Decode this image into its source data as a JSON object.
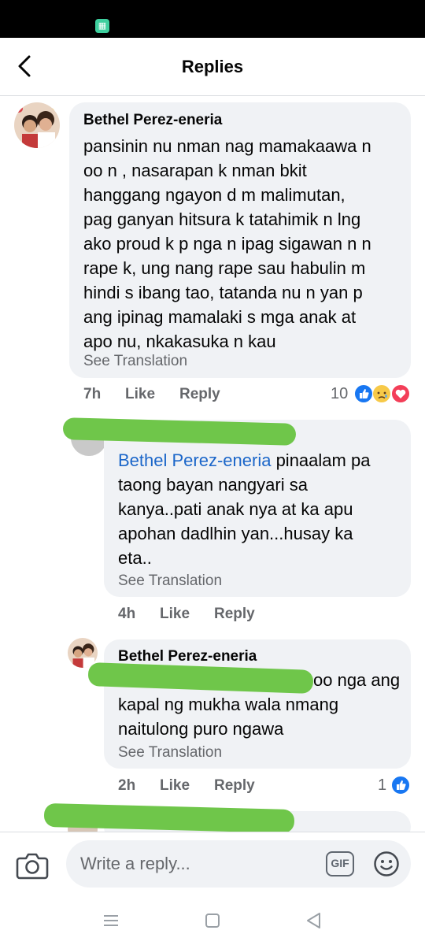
{
  "status_bar": {
    "notification_icon": "calculator-app-icon"
  },
  "header": {
    "title": "Replies",
    "back_icon": "back-arrow-icon"
  },
  "comments": [
    {
      "author": "Bethel Perez-eneria",
      "lines": [
        "pansinin nu nman nag mamakaawa n",
        "oo n , nasarapan k nman bkit",
        "hanggang ngayon d m malimutan,",
        "pag ganyan hitsura k tatahimik n lng",
        "ako proud k p nga n ipag sigawan n n",
        "rape k, ung nang rape sau habulin m",
        "hindi s ibang tao, tatanda nu n yan p",
        "ang ipinag mamalaki s mga anak at",
        "apo nu, nkakasuka n kau"
      ],
      "see_translation": "See Translation",
      "time": "7h",
      "like": "Like",
      "reply": "Reply",
      "reaction_count": "10",
      "reactions": [
        "like-reaction-icon",
        "sad-reaction-icon",
        "love-reaction-icon"
      ]
    },
    {
      "author": "",
      "mention": "Bethel Perez-eneria",
      "lines": [
        " pinaalam pa",
        "taong bayan nangyari sa",
        "kanya..pati anak nya at ka apu",
        "apohan dadlhin yan...husay ka",
        "eta.."
      ],
      "see_translation": "See Translation",
      "time": "4h",
      "like": "Like",
      "reply": "Reply"
    },
    {
      "author": "Bethel Perez-eneria",
      "lines": [
        "oo nga ang",
        "kapal ng mukha wala nmang",
        "naitulong puro ngawa"
      ],
      "see_translation": "See Translation",
      "time": "2h",
      "like": "Like",
      "reply": "Reply",
      "reaction_count": "1",
      "reactions": [
        "like-reaction-icon"
      ]
    }
  ],
  "composer": {
    "placeholder": "Write a reply...",
    "gif_label": "GIF",
    "camera_icon": "camera-icon",
    "emoji_icon": "emoji-icon"
  },
  "navbar": {
    "menu_icon": "recent-apps-icon",
    "home_icon": "home-icon",
    "back_icon": "back-triangle-icon"
  },
  "colors": {
    "mention": "#1b66c9",
    "bubble": "#f0f2f5",
    "meta": "#65676b",
    "redaction": "#6fc64a"
  }
}
